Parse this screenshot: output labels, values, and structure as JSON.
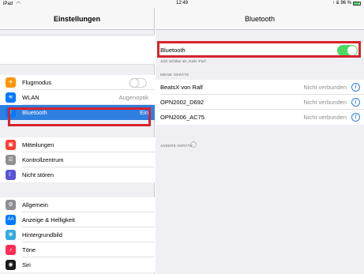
{
  "status_bar": {
    "device": "iPad  ◠",
    "time": "12:49",
    "indicators": "↑ & 96 %"
  },
  "sidebar": {
    "title": "Einstellungen",
    "items": [
      {
        "label": "Flugmodus",
        "icon": "airplane-icon",
        "color": "#ff9500",
        "toggle": false
      },
      {
        "label": "WLAN",
        "value": "Augenoptik",
        "icon": "wifi-icon",
        "color": "#007aff"
      },
      {
        "label": "Bluetooth",
        "value": "Ein",
        "icon": "bluetooth-icon",
        "color": "#007aff",
        "selected": true
      },
      {
        "label": "Mitteilungen",
        "icon": "notifications-icon",
        "color": "#ff3b30"
      },
      {
        "label": "Kontrollzentrum",
        "icon": "control-center-icon",
        "color": "#8e8e93"
      },
      {
        "label": "Nicht stören",
        "icon": "moon-icon",
        "color": "#5856d6"
      },
      {
        "label": "Allgemein",
        "icon": "gear-icon",
        "color": "#8e8e93"
      },
      {
        "label": "Anzeige & Helligkeit",
        "icon": "display-icon",
        "color": "#007aff"
      },
      {
        "label": "Hintergrundbild",
        "icon": "wallpaper-icon",
        "color": "#34aadc"
      },
      {
        "label": "Töne",
        "icon": "sound-icon",
        "color": "#ff2d55"
      },
      {
        "label": "Siri",
        "icon": "siri-icon",
        "color": "#1c1c1e"
      }
    ]
  },
  "detail": {
    "title": "Bluetooth",
    "bluetooth_label": "Bluetooth",
    "bluetooth_on": true,
    "visible_caption": "Jetzt sichtbar als „Ralfs iPad“.",
    "my_devices_header": "MEINE GERÄTE",
    "devices": [
      {
        "name": "BeatsX von Ralf",
        "status": "Nicht verbunden"
      },
      {
        "name": "OPN2002_D692",
        "status": "Nicht verbunden"
      },
      {
        "name": "OPN2006_AC75",
        "status": "Nicht verbunden"
      }
    ],
    "other_devices_header": "ANDERE GERÄTE"
  },
  "colors": {
    "highlight": "#d8222a",
    "selected": "#2f7fe0",
    "toggle_on": "#4cd964"
  }
}
